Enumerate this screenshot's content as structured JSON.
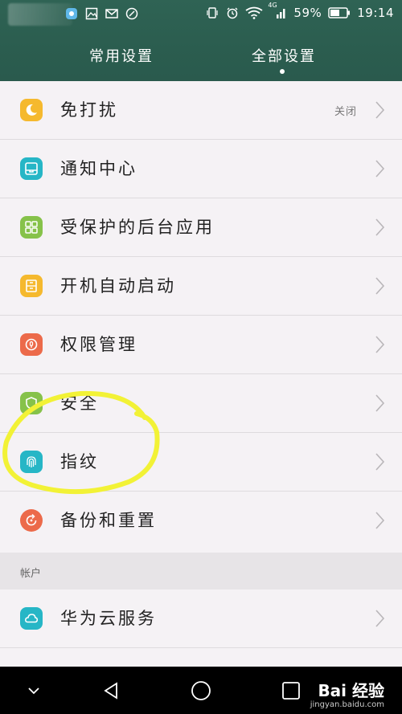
{
  "status_bar": {
    "network_tag": "4G",
    "battery": "59%",
    "time": "19:14"
  },
  "tabs": [
    {
      "label": "常用设置"
    },
    {
      "label": "全部设置"
    }
  ],
  "settings": [
    {
      "label": "免打扰",
      "value": "关闭",
      "icon": "moon-icon",
      "color": "#f5b92e"
    },
    {
      "label": "通知中心",
      "value": "",
      "icon": "notification-icon",
      "color": "#26b6c6"
    },
    {
      "label": "受保护的后台应用",
      "value": "",
      "icon": "grid-apps-icon",
      "color": "#86c24a"
    },
    {
      "label": "开机自动启动",
      "value": "",
      "icon": "startup-icon",
      "color": "#f5b92e"
    },
    {
      "label": "权限管理",
      "value": "",
      "icon": "lock-icon",
      "color": "#ec6a4a"
    },
    {
      "label": "安全",
      "value": "",
      "icon": "shield-icon",
      "color": "#86c24a"
    },
    {
      "label": "指纹",
      "value": "",
      "icon": "fingerprint-icon",
      "color": "#26b6c6"
    },
    {
      "label": "备份和重置",
      "value": "",
      "icon": "backup-icon",
      "color": "#ec6a4a"
    }
  ],
  "section": {
    "title": "帐户"
  },
  "account_items": [
    {
      "label": "华为云服务",
      "value": "",
      "icon": "cloud-icon",
      "color": "#26b6c6"
    }
  ],
  "watermark": {
    "brand": "Bai  经验",
    "url": "jingyan.baidu.com"
  },
  "colors": {
    "header_bg": "#2b5d4f",
    "annotation": "#f2f236"
  }
}
